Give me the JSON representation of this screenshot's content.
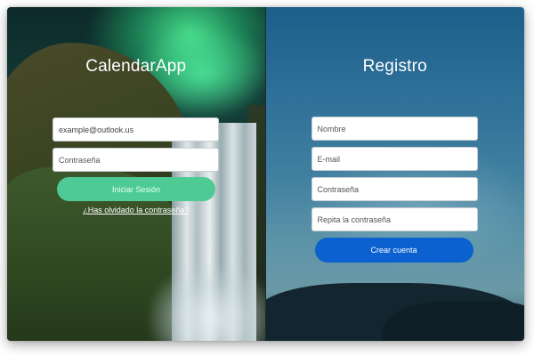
{
  "login": {
    "app_title": "CalendarApp",
    "email": {
      "value": "example@outlook.us",
      "placeholder": ""
    },
    "password": {
      "placeholder": "Contraseña"
    },
    "submit_label": "Iniciar Sesión",
    "forgot_link": "¿Has olvidado la contraseña?"
  },
  "register": {
    "title": "Registro",
    "name": {
      "placeholder": "Nombre"
    },
    "email": {
      "placeholder": "E-mail"
    },
    "password": {
      "placeholder": "Contraseña"
    },
    "repeat_password": {
      "placeholder": "Repita la contraseña"
    },
    "submit_label": "Crear cuenta"
  },
  "colors": {
    "login_button": "#4ecb94",
    "create_button": "#0a61cf",
    "title_text": "#ffffff"
  }
}
